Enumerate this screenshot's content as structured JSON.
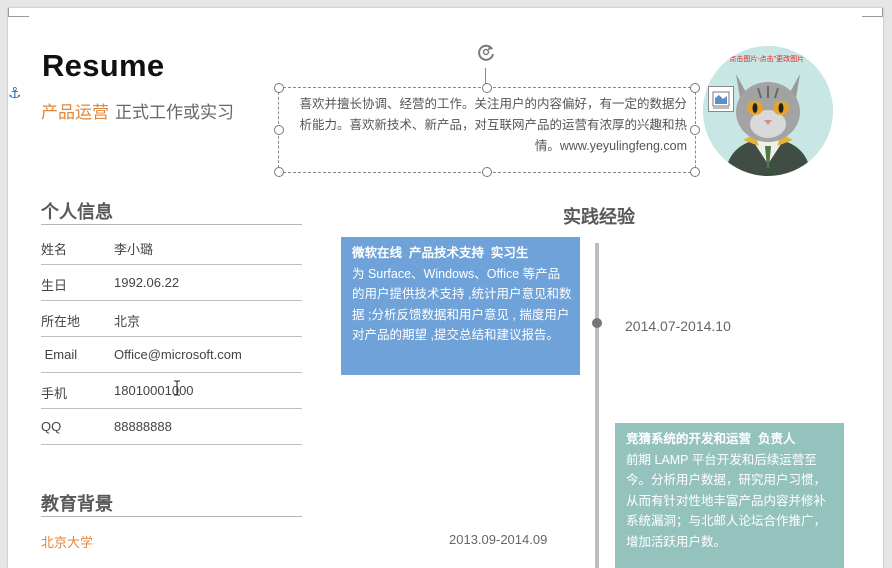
{
  "header": {
    "title": "Resume",
    "role": "产品运营",
    "job_type": "正式工作或实习"
  },
  "intro": {
    "text": "喜欢并擅长协调、经营的工作。关注用户的内容偏好，有一定的数据分析能力。喜欢新技术、新产品，对互联网产品的运营有浓厚的兴趣和热情。www.yeyulingfeng.com"
  },
  "avatar": {
    "overlay_text": "点击图片-点击\"更改图片\""
  },
  "personal_info": {
    "title": "个人信息",
    "rows": [
      {
        "label": "姓名",
        "value": "李小璐"
      },
      {
        "label": "生日",
        "value": "1992.06.22"
      },
      {
        "label": "所在地",
        "value": "北京"
      },
      {
        "label": " Email",
        "value": "Office@microsoft.com"
      },
      {
        "label": "手机",
        "value": "18010001000"
      },
      {
        "label": "QQ",
        "value": "88888888"
      }
    ]
  },
  "education": {
    "title": "教育背景",
    "school": "北京大学",
    "date": "2013.09-2014.09"
  },
  "experience": {
    "title": "实践经验",
    "items": [
      {
        "heading": "微软在线  产品技术支持  实习生",
        "body": "为 Surface、Windows、Office 等产品的用户提供技术支持 ,统计用户意见和数据 ;分析反馈数据和用户意见 , 揣度用户对产品的期望 ,提交总结和建议报告。",
        "date": "2014.07-2014.10"
      },
      {
        "heading": "竞猜系统的开发和运营  负责人",
        "body": "前期 LAMP 平台开发和后续运营至今。分析用户数据，研究用户习惯，从而有针对性地丰富产品内容并修补系统漏洞；与北邮人论坛合作推广，增加活跃用户数。"
      }
    ]
  },
  "colors": {
    "accent_orange": "#e2873a",
    "card_blue": "#6fa2d8",
    "card_teal": "#94c3be",
    "heading_gray": "#595959"
  }
}
